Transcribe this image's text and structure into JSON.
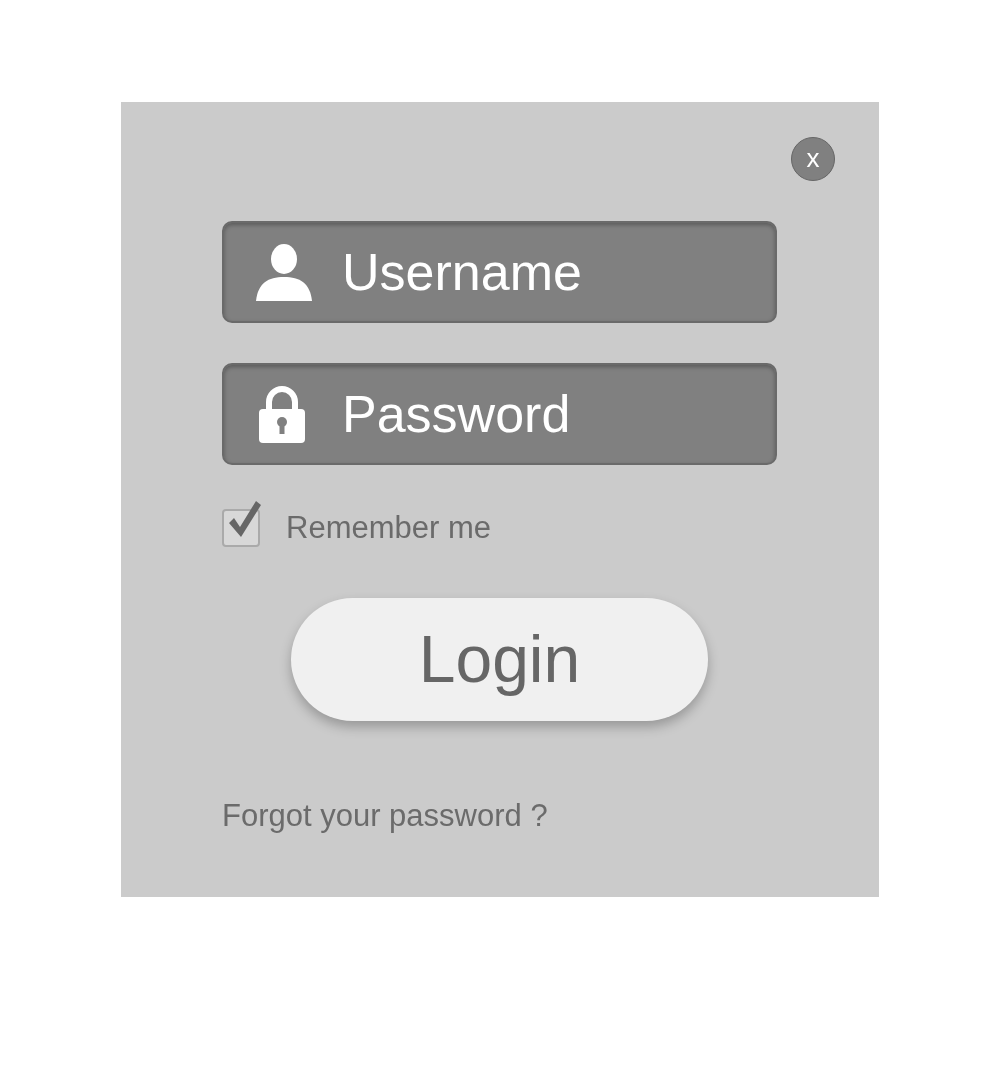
{
  "close": {
    "label": "x"
  },
  "username": {
    "placeholder": "Username"
  },
  "password": {
    "placeholder": "Password"
  },
  "remember": {
    "label": "Remember me",
    "checked": true
  },
  "login": {
    "label": "Login"
  },
  "forgot": {
    "label": "Forgot your password ?"
  }
}
